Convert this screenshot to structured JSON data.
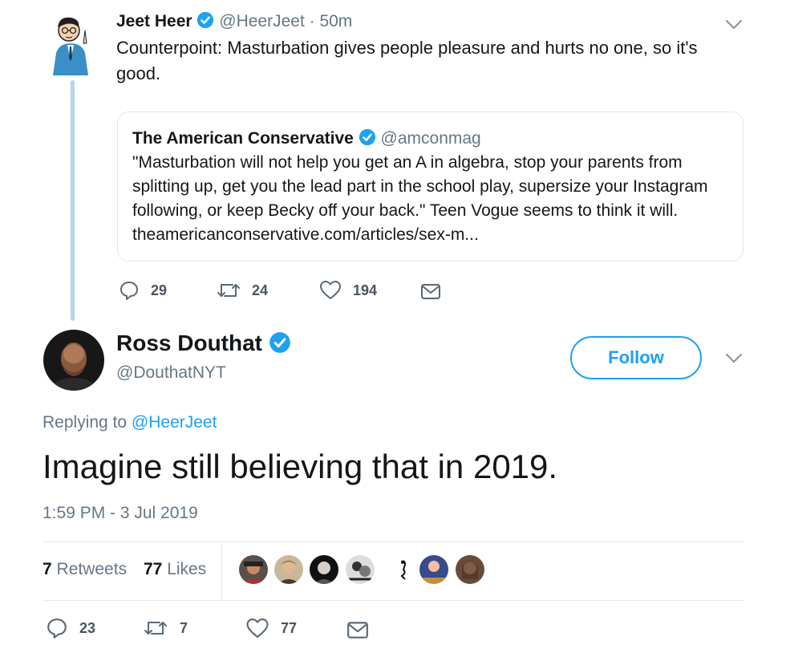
{
  "parent_tweet": {
    "author_name": "Jeet Heer",
    "handle": "@HeerJeet",
    "time": "· 50m",
    "text": "Counterpoint: Masturbation gives people pleasure and hurts no one, so it's good.",
    "quoted": {
      "author_name": "The American Conservative",
      "handle": "@amconmag",
      "text": "\"Masturbation will not help you get an A in algebra, stop your parents from splitting up, get you the lead part in the school play, supersize your Instagram following, or keep Becky off your back.\" Teen Vogue seems to think it will. theamericanconservative.com/articles/sex-m..."
    },
    "replies": "29",
    "retweets": "24",
    "likes": "194"
  },
  "main_tweet": {
    "author_name": "Ross Douthat",
    "handle": "@DouthatNYT",
    "follow_label": "Follow",
    "replying_prefix": "Replying to",
    "replying_handle": "@HeerJeet",
    "text": "Imagine still believing that in 2019.",
    "timestamp": "1:59 PM - 3 Jul 2019",
    "retweets_count": "7",
    "retweets_label": "Retweets",
    "likes_count": "77",
    "likes_label": "Likes",
    "replies": "23",
    "retweets": "7",
    "likes": "77"
  },
  "colors": {
    "accent": "#1da1f2",
    "thread_line": "#b7d4ea",
    "muted": "#657786"
  }
}
